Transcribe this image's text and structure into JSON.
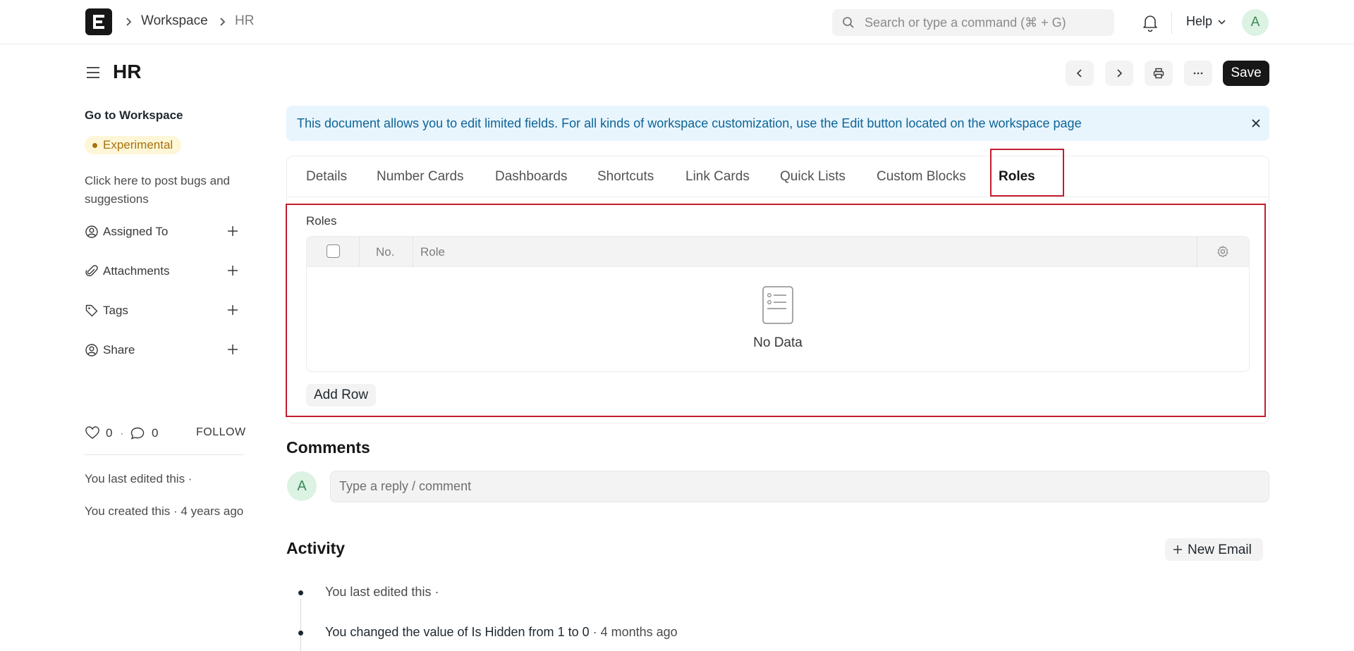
{
  "navbar": {
    "logo_letter": "E",
    "breadcrumbs": [
      "Workspace",
      "HR"
    ],
    "search_placeholder": "Search or type a command (⌘ + G)",
    "help_label": "Help",
    "avatar_letter": "A"
  },
  "header": {
    "title": "HR",
    "save_label": "Save"
  },
  "sidebar": {
    "goto_label": "Go to Workspace",
    "badge_label": "Experimental",
    "bugs_link": "Click here to post bugs and suggestions",
    "items": [
      {
        "label": "Assigned To",
        "icon": "assign-icon"
      },
      {
        "label": "Attachments",
        "icon": "paperclip-icon"
      },
      {
        "label": "Tags",
        "icon": "tag-icon"
      },
      {
        "label": "Share",
        "icon": "share-icon"
      }
    ],
    "likes_count": "0",
    "comments_count": "0",
    "follow_label": "FOLLOW",
    "last_edited": "You last edited this ·",
    "created": "You created this · 4 years ago"
  },
  "alert": {
    "text": "This document allows you to edit limited fields. For all kinds of workspace customization, use the Edit button located on the workspace page"
  },
  "tabs": [
    {
      "label": "Details"
    },
    {
      "label": "Number Cards"
    },
    {
      "label": "Dashboards"
    },
    {
      "label": "Shortcuts"
    },
    {
      "label": "Link Cards"
    },
    {
      "label": "Quick Lists"
    },
    {
      "label": "Custom Blocks"
    },
    {
      "label": "Roles",
      "active": true
    }
  ],
  "roles_section": {
    "label": "Roles",
    "columns": [
      "No.",
      "Role"
    ],
    "empty_text": "No Data",
    "add_row_label": "Add Row"
  },
  "comments": {
    "title": "Comments",
    "avatar_letter": "A",
    "placeholder": "Type a reply / comment"
  },
  "activity": {
    "title": "Activity",
    "new_email_label": "New Email",
    "items": [
      {
        "text": "You last edited this ·"
      },
      {
        "prefix": "You changed the value of Is Hidden from ",
        "from": "1",
        "mid": " to ",
        "to": "0",
        "suffix": " · 4 months ago"
      }
    ]
  },
  "colors": {
    "primary": "#171717",
    "highlight": "#c31d2f",
    "alert_bg": "#e8f5fd",
    "alert_text": "#0e6497",
    "badge_bg": "#fdf6d7",
    "badge_text": "#a8710d"
  }
}
